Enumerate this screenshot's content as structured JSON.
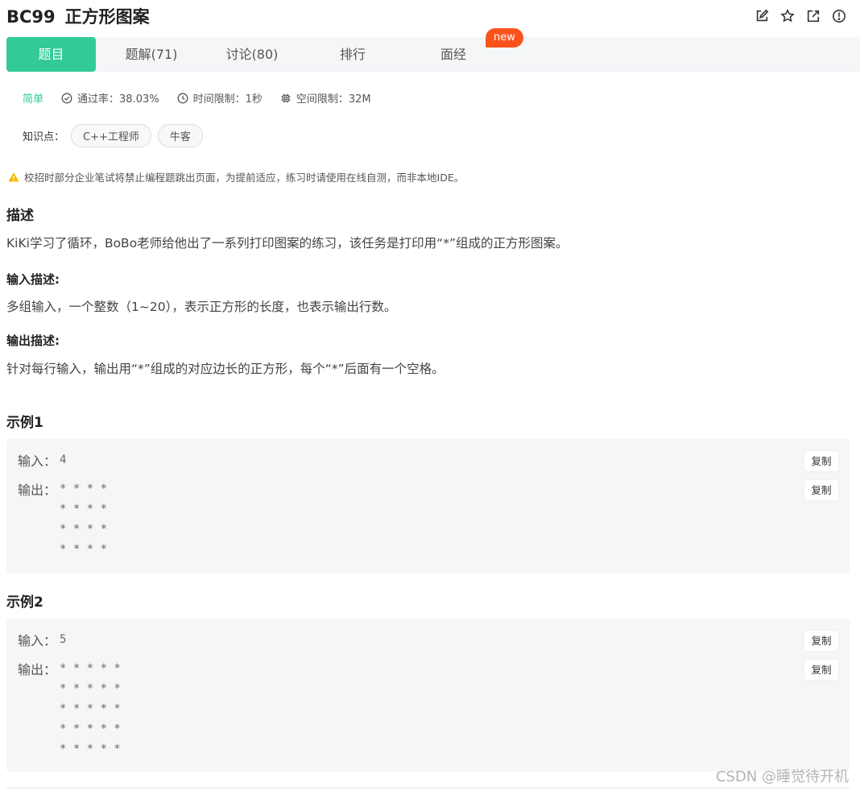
{
  "problem": {
    "code": "BC99",
    "title": "正方形图案"
  },
  "header_icons": [
    "edit-icon",
    "star-icon",
    "share-icon",
    "report-icon"
  ],
  "tabs": [
    {
      "label": "题目",
      "active": true
    },
    {
      "label": "题解(71)"
    },
    {
      "label": "讨论(80)"
    },
    {
      "label": "排行"
    },
    {
      "label": "面经"
    }
  ],
  "badge_new": "new",
  "meta": {
    "difficulty": "简单",
    "pass_rate": "通过率：38.03%",
    "time_limit": "时间限制：1秒",
    "space_limit": "空间限制：32M"
  },
  "knowledge": {
    "label": "知识点：",
    "tags": [
      "C++工程师",
      "牛客"
    ]
  },
  "warning": "校招时部分企业笔试将禁止编程题跳出页面，为提前适应，练习时请使用在线自测，而非本地IDE。",
  "description": {
    "heading": "描述",
    "text": "KiKi学习了循环，BoBo老师给他出了一系列打印图案的练习，该任务是打印用“*”组成的正方形图案。"
  },
  "input_desc": {
    "heading": "输入描述:",
    "text": "多组输入，一个整数（1~20），表示正方形的长度，也表示输出行数。"
  },
  "output_desc": {
    "heading": "输出描述:",
    "text": "针对每行输入，输出用“*”组成的对应边长的正方形，每个“*”后面有一个空格。"
  },
  "examples": [
    {
      "heading": "示例1",
      "input_label": "输入：",
      "input_value": "4",
      "output_label": "输出：",
      "output_value": "* * * *\n* * * *\n* * * *\n* * * *",
      "copy_label": "复制"
    },
    {
      "heading": "示例2",
      "input_label": "输入：",
      "input_value": "5",
      "output_label": "输出：",
      "output_value": "* * * * *\n* * * * *\n* * * * *\n* * * * *\n* * * * *",
      "copy_label": "复制"
    }
  ],
  "watermark": "CSDN @睡觉待开机",
  "colors": {
    "accent": "#32ca99",
    "new_badge": "#fa541c",
    "warning": "#f5b800"
  }
}
